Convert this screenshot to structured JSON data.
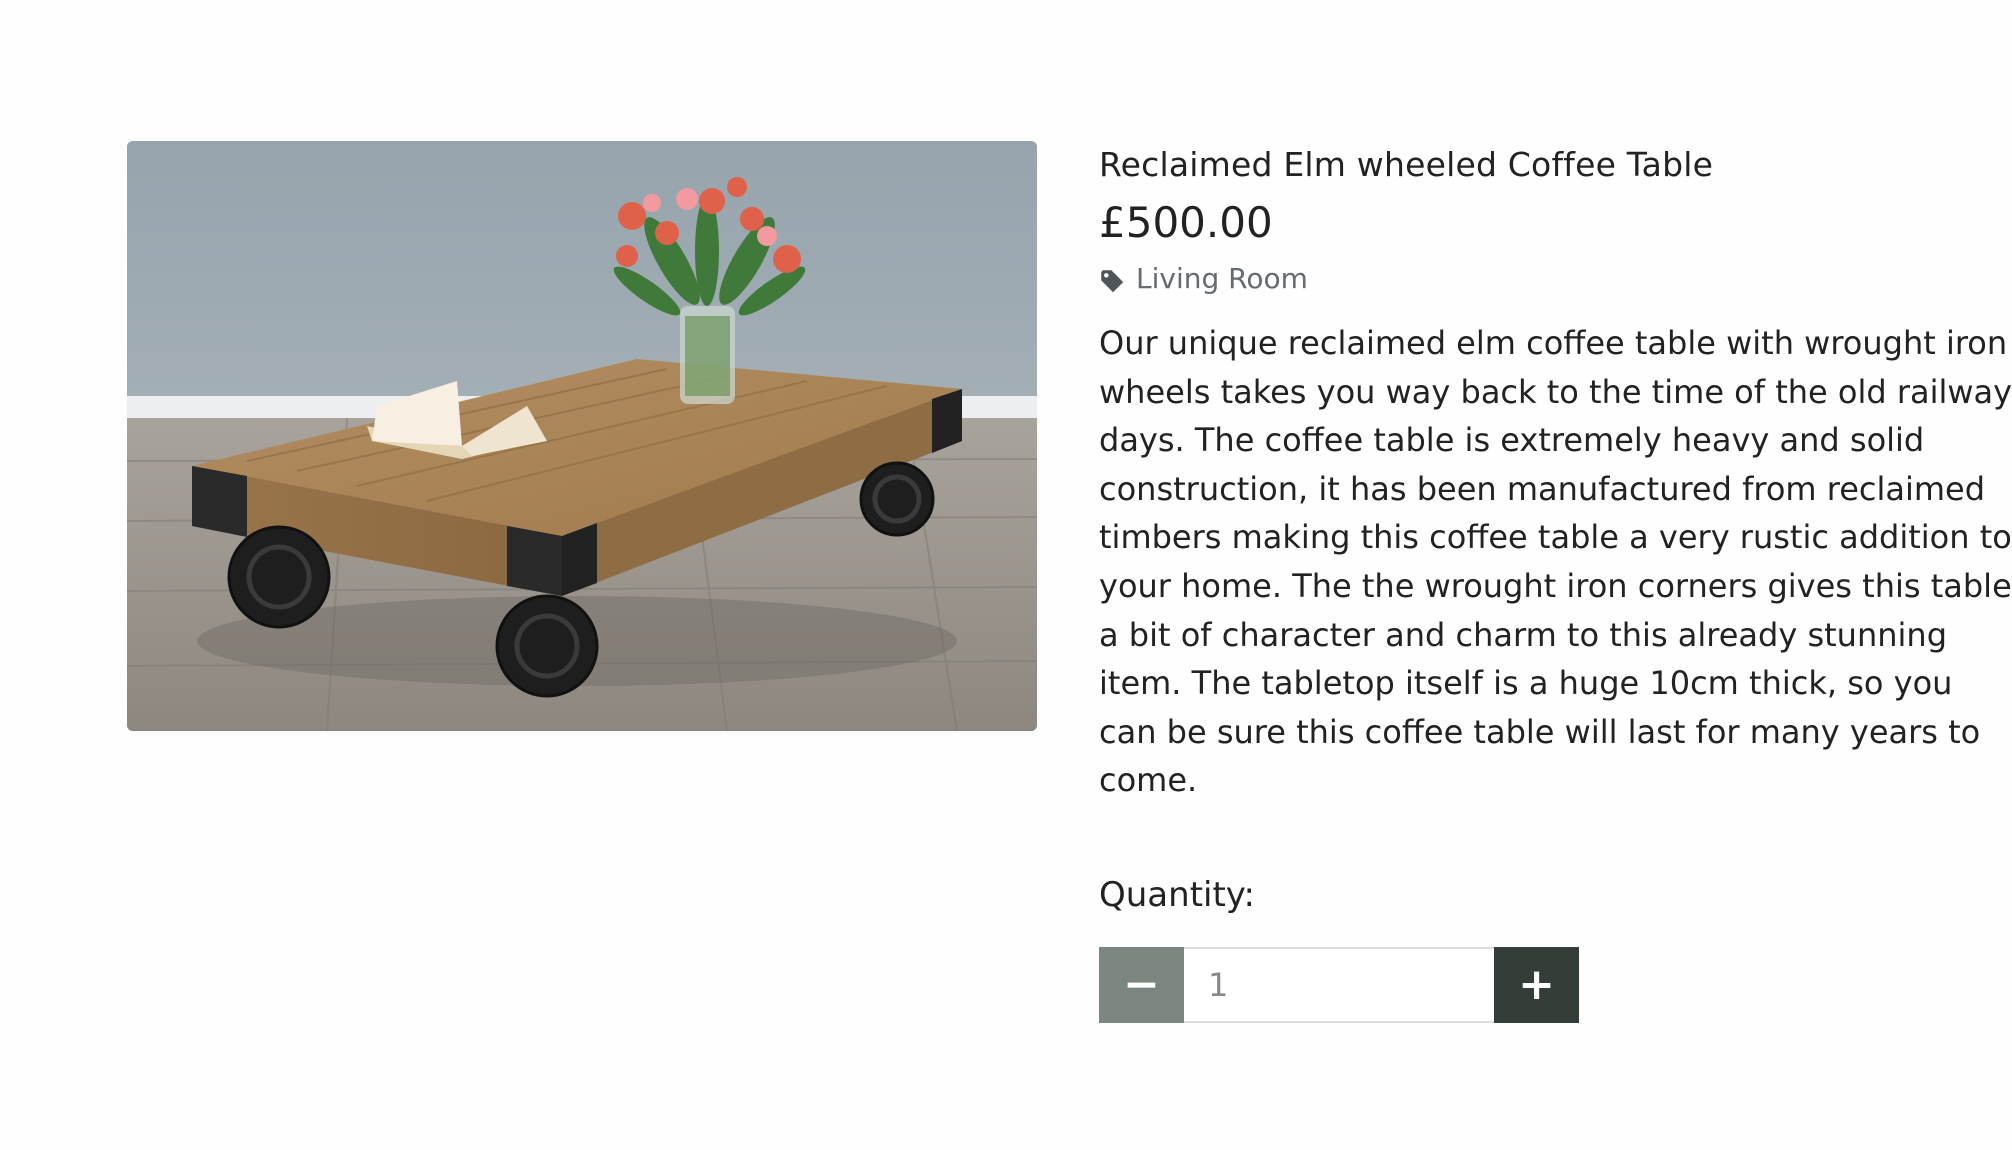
{
  "product": {
    "title": "Reclaimed Elm wheeled Coffee Table",
    "price": "£500.00",
    "category": "Living Room",
    "description": "Our unique reclaimed elm coffee table with wrought iron wheels takes you way back to the time of the old railway days. The coffee table is extremely heavy and solid construction, it has been manufactured from reclaimed timbers making this coffee table a very rustic addition to your home. The the wrought iron corners gives this table a bit of character and charm to this already stunning item. The tabletop itself is a huge 10cm thick, so you can be sure this coffee table will last for many years to come."
  },
  "quantity": {
    "label": "Quantity:",
    "value": "1",
    "minus_label": "−",
    "plus_label": "+"
  },
  "icons": {
    "category": "tag-icon"
  },
  "colors": {
    "minus_button": "#7d8581",
    "plus_button": "#353d39",
    "text": "#222222",
    "muted_text": "#666b70"
  }
}
